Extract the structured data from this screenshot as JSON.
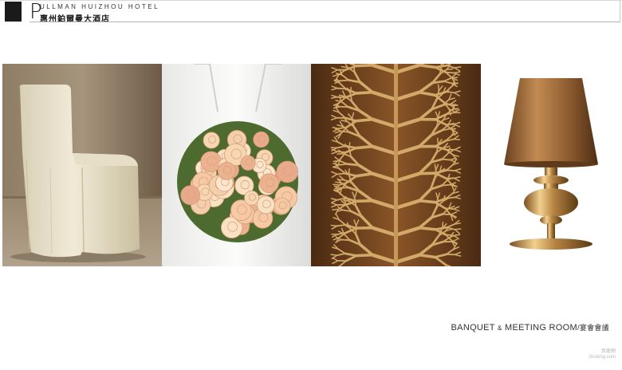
{
  "header": {
    "logo_letter": "P",
    "hotel_name_en": "ULLMAN HUIZHOU HOTEL",
    "hotel_name_cn": "惠州鉑爾曼大酒店"
  },
  "caption": {
    "part1": "BANQUET",
    "amp": "&",
    "part2": "MEETING ROOM",
    "cn": "/宴會會議"
  },
  "watermark": {
    "line1": "筑龍網",
    "line2": "zhulong.com"
  },
  "colors": {
    "accent_dark": "#1a1a1a",
    "bronze": "#b8864e",
    "wood": "#7a4a22"
  }
}
